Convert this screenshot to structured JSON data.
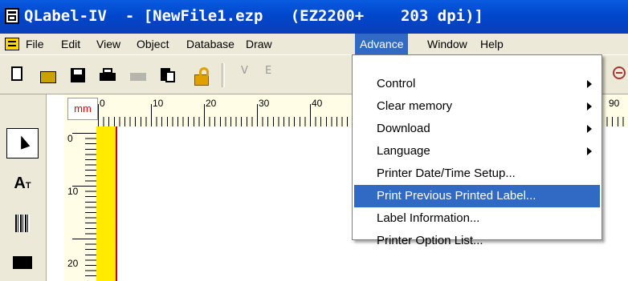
{
  "window": {
    "title": "QLabel-IV  - [NewFile1.ezp   (EZ2200+    203 dpi)]"
  },
  "menubar": {
    "items": [
      "File",
      "Edit",
      "View",
      "Object",
      "Database",
      "Draw",
      "Advance",
      "Window",
      "Help"
    ],
    "active": "Advance"
  },
  "toolbar": {
    "icons": [
      "new-icon",
      "open-icon",
      "save-icon",
      "print-icon",
      "print-preview-icon",
      "copy-icon",
      "lock-icon",
      "vertical-text-icon",
      "edit-icon",
      "zoom-out-icon"
    ],
    "partial_labels": {
      "v": "V",
      "e": "E"
    }
  },
  "tools": [
    "pointer-icon",
    "text-tool-icon",
    "barcode-tool-icon",
    "rectangle-tool-icon"
  ],
  "text_tool_label": {
    "big": "A",
    "small": "T"
  },
  "ruler": {
    "unit": "mm",
    "top_numbers": [
      "0",
      "10",
      "20",
      "30",
      "40",
      "90"
    ],
    "left_numbers": [
      "0",
      "10",
      "20"
    ]
  },
  "dropdown": {
    "items": [
      {
        "label": "Control",
        "submenu": true
      },
      {
        "label": "Clear memory",
        "submenu": true
      },
      {
        "label": "Download",
        "submenu": true
      },
      {
        "label": "Language",
        "submenu": true
      },
      {
        "label": "Printer Date/Time Setup...",
        "submenu": false
      },
      {
        "label": "Print Previous Printed Label...",
        "submenu": false,
        "highlighted": true
      },
      {
        "label": "Label Information...",
        "submenu": false
      },
      {
        "label": "Printer Option List...",
        "submenu": false
      }
    ]
  },
  "colors": {
    "titlebar": "#0047cc",
    "highlight": "#316ac5",
    "ruler_bg": "#fffde6",
    "strip": "#ffea00"
  }
}
